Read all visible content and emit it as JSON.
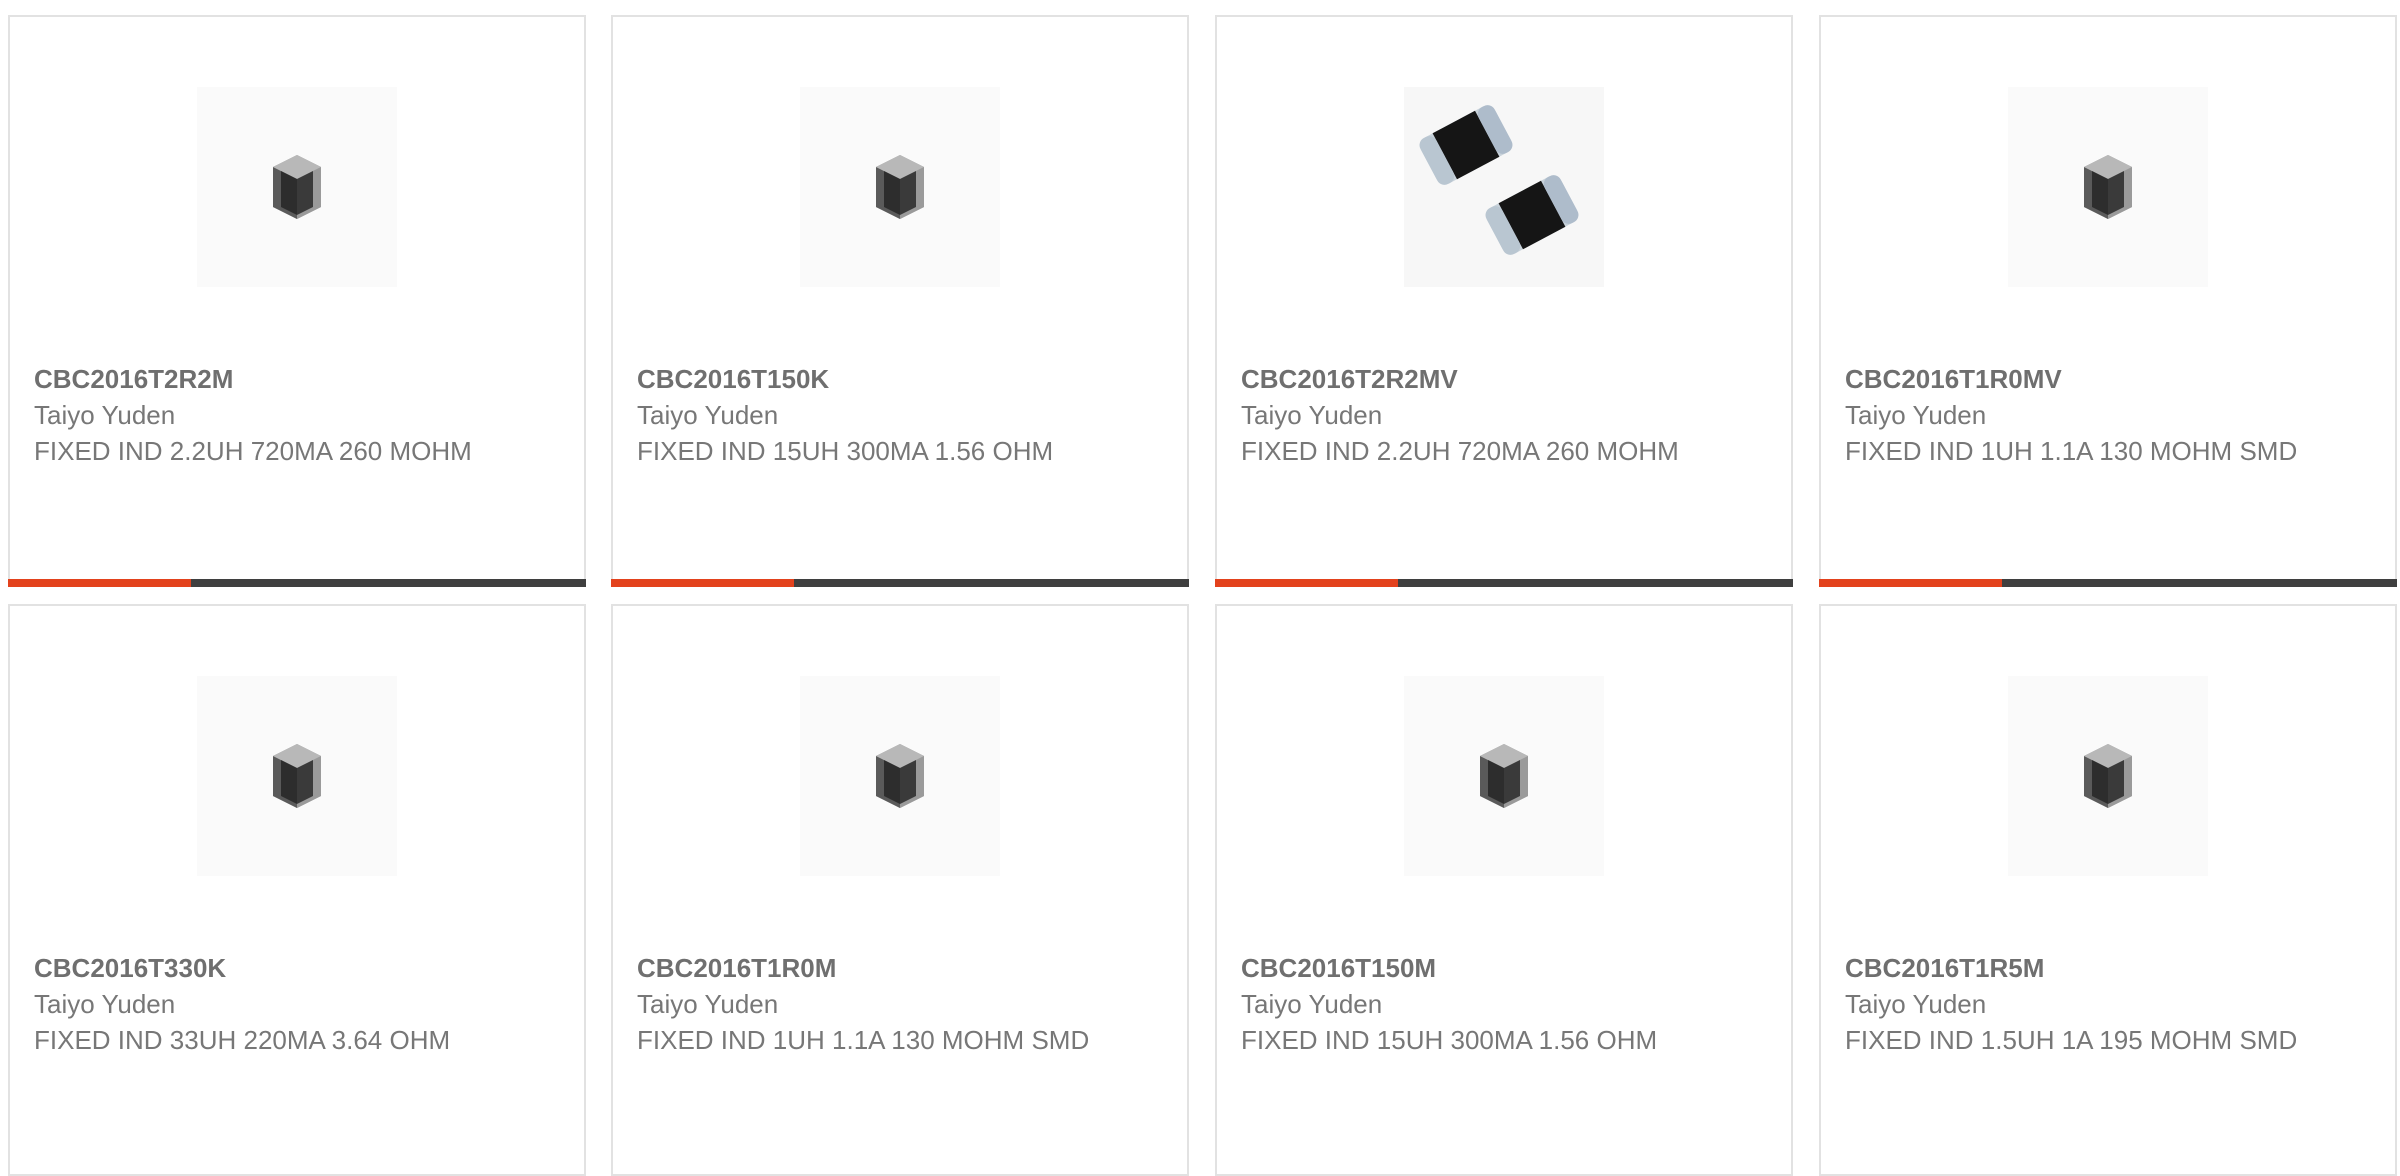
{
  "colors": {
    "accent": "#e3421d",
    "bar": "#3f3f3f",
    "border": "#e2e2e2",
    "text": "#777777"
  },
  "products": [
    {
      "part": "CBC2016T2R2M",
      "manufacturer": "Taiyo Yuden",
      "description": "FIXED IND 2.2UH 720MA 260 MOHM",
      "image": "single-chip-inductor"
    },
    {
      "part": "CBC2016T150K",
      "manufacturer": "Taiyo Yuden",
      "description": "FIXED IND 15UH 300MA 1.56 OHM",
      "image": "single-chip-inductor"
    },
    {
      "part": "CBC2016T2R2MV",
      "manufacturer": "Taiyo Yuden",
      "description": "FIXED IND 2.2UH 720MA 260 MOHM",
      "image": "dual-chip-inductor"
    },
    {
      "part": "CBC2016T1R0MV",
      "manufacturer": "Taiyo Yuden",
      "description": "FIXED IND 1UH 1.1A 130 MOHM SMD",
      "image": "single-chip-inductor"
    },
    {
      "part": "CBC2016T330K",
      "manufacturer": "Taiyo Yuden",
      "description": "FIXED IND 33UH 220MA 3.64 OHM",
      "image": "single-chip-inductor"
    },
    {
      "part": "CBC2016T1R0M",
      "manufacturer": "Taiyo Yuden",
      "description": "FIXED IND 1UH 1.1A 130 MOHM SMD",
      "image": "single-chip-inductor"
    },
    {
      "part": "CBC2016T150M",
      "manufacturer": "Taiyo Yuden",
      "description": "FIXED IND 15UH 300MA 1.56 OHM",
      "image": "single-chip-inductor"
    },
    {
      "part": "CBC2016T1R5M",
      "manufacturer": "Taiyo Yuden",
      "description": "FIXED IND 1.5UH 1A 195 MOHM SMD",
      "image": "single-chip-inductor"
    }
  ]
}
